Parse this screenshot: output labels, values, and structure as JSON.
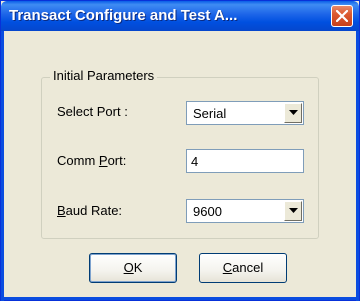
{
  "window": {
    "title": "Transact Configure and Test A...",
    "close_icon": "close-icon"
  },
  "group": {
    "legend": "Initial Parameters"
  },
  "fields": {
    "select_port": {
      "label_pre": "Select Port :",
      "value": "Serial"
    },
    "comm_port": {
      "label_pre": "Comm ",
      "label_accel": "P",
      "label_post": "ort:",
      "value": "4"
    },
    "baud_rate": {
      "label_accel": "B",
      "label_post": "aud Rate:",
      "value": "9600"
    }
  },
  "buttons": {
    "ok": {
      "accel": "O",
      "rest": "K"
    },
    "cancel": {
      "accel": "C",
      "rest": "ancel"
    }
  },
  "colors": {
    "titlebar": "#0054e3",
    "dialog_bg": "#ece9d8",
    "close_btn": "#dc5a30"
  }
}
